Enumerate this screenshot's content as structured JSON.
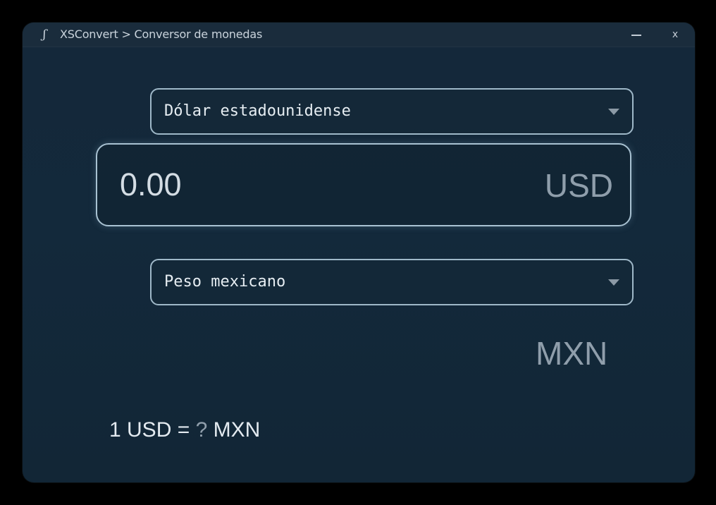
{
  "window": {
    "title": "XSConvert > Conversor de monedas",
    "app_icon": "ꟗ",
    "minimize_icon": "minimize-icon",
    "close_label": "x"
  },
  "from": {
    "currency_name": "Dólar estadounidense",
    "amount_value": "0.00",
    "currency_code": "USD"
  },
  "to": {
    "currency_name": "Peso mexicano",
    "currency_code": "MXN"
  },
  "rate": {
    "prefix": "1 USD = ",
    "value": "?",
    "suffix": " MXN"
  },
  "colors": {
    "background": "#13293b",
    "border": "#a9c2d2",
    "muted_text": "#8f9eab",
    "text": "#e3eaf0"
  }
}
